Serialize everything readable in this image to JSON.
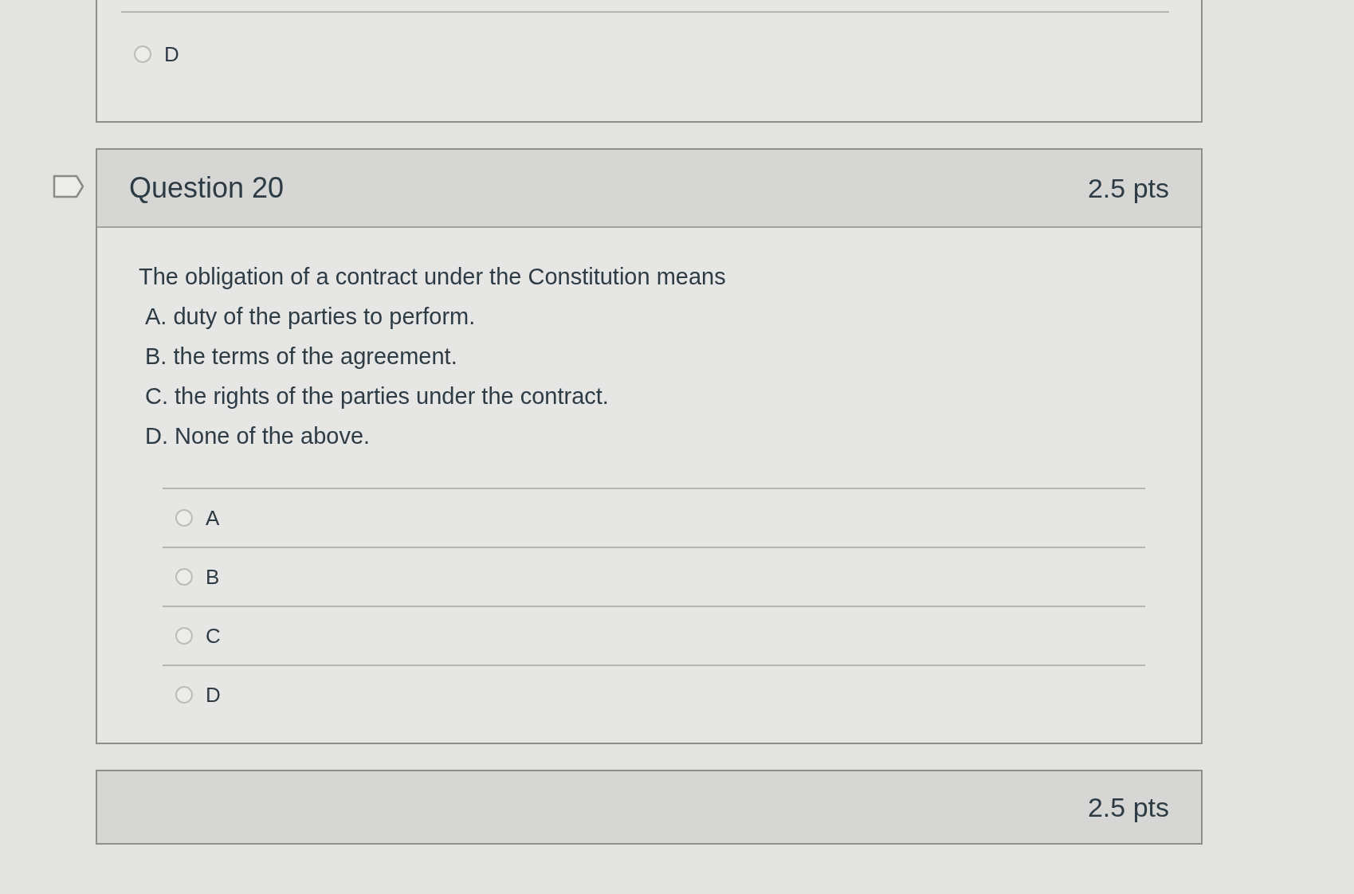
{
  "previous_question": {
    "answers": [
      {
        "label": "D",
        "selected": false
      }
    ]
  },
  "question": {
    "flagged": false,
    "title": "Question 20",
    "points": "2.5 pts",
    "prompt": "The obligation of a contract under the Constitution means",
    "prompt_lines": [
      "A. duty of the parties to perform.",
      "B. the terms of the agreement.",
      "C. the rights of the parties under the contract.",
      "D. None of the above."
    ],
    "answers": [
      {
        "label": "A",
        "selected": false
      },
      {
        "label": "B",
        "selected": false
      },
      {
        "label": "C",
        "selected": false
      },
      {
        "label": "D",
        "selected": false
      }
    ]
  },
  "next_question": {
    "points": "2.5 pts"
  }
}
